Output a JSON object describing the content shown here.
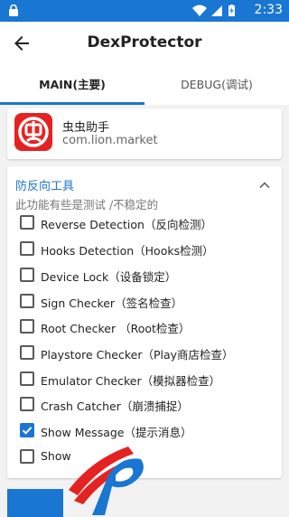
{
  "status_bar": {
    "time": "2:33",
    "icons": [
      "lock-icon",
      "wifi-icon",
      "signal-icon",
      "battery-icon"
    ],
    "color": "#1976d2"
  },
  "app_bar": {
    "title": "DexProtector",
    "back_icon": "arrow-back-icon"
  },
  "tabs": [
    {
      "label": "MAIN(主要)",
      "active": true
    },
    {
      "label": "DEBUG(调试)",
      "active": false
    }
  ],
  "app_info": {
    "name": "虫虫助手",
    "package": "com.lion.market",
    "icon_color": "#e52222"
  },
  "section": {
    "title": "防反向工具",
    "subtitle": "此功能有些是测试 /不稳定的",
    "options": [
      {
        "label": "Reverse Detection（反向检测）",
        "checked": false
      },
      {
        "label": "Hooks Detection（Hooks检测）",
        "checked": false
      },
      {
        "label": "Device Lock（设备锁定）",
        "checked": false
      },
      {
        "label": "Sign Checker（签名检查）",
        "checked": false
      },
      {
        "label": "Root Checker （Root检查）",
        "checked": false
      },
      {
        "label": "Playstore Checker（Play商店检查）",
        "checked": false
      },
      {
        "label": "Emulator Checker（模拟器检查）",
        "checked": false
      },
      {
        "label": "Crash Catcher（崩溃捕捉）",
        "checked": false
      },
      {
        "label": "Show Message（提示消息）",
        "checked": true
      },
      {
        "label": "Show",
        "checked": false
      }
    ]
  },
  "accent_color": "#1976d2"
}
